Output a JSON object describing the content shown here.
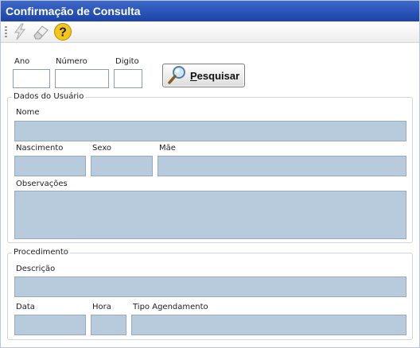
{
  "window": {
    "title": "Confirmação de Consulta"
  },
  "toolbar": {
    "items": [
      {
        "icon": "lightning-icon"
      },
      {
        "icon": "eraser-icon"
      },
      {
        "icon": "help-icon"
      }
    ]
  },
  "search": {
    "ano_label": "Ano",
    "ano_value": "",
    "numero_label": "Número",
    "numero_value": "",
    "digito_label": "Digito",
    "digito_value": "",
    "button_accesskey": "P",
    "button_rest": "esquisar"
  },
  "dados_usuario": {
    "legend": "Dados do Usuário",
    "nome_label": "Nome",
    "nome_value": "",
    "nascimento_label": "Nascimento",
    "nascimento_value": "",
    "sexo_label": "Sexo",
    "sexo_value": "",
    "mae_label": "Mãe",
    "mae_value": "",
    "observacoes_label": "Observações",
    "observacoes_value": ""
  },
  "procedimento": {
    "legend": "Procedimento",
    "descricao_label": "Descrição",
    "descricao_value": "",
    "data_label": "Data",
    "data_value": "",
    "hora_label": "Hora",
    "hora_value": "",
    "tipo_label": "Tipo Agendamento",
    "tipo_value": ""
  },
  "colors": {
    "title_bar": "#1b43a8",
    "readonly_field": "#b8cbdc",
    "title_text": "#ffffff"
  }
}
